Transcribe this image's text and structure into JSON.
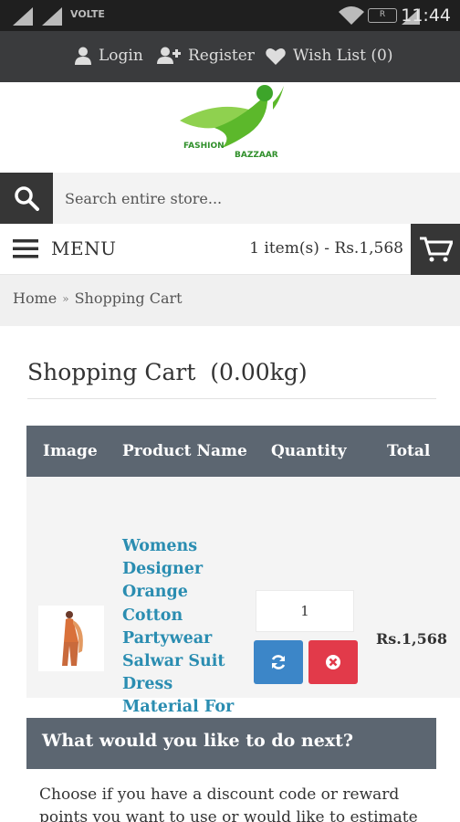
{
  "status_bar": {
    "network_label": "VOLTE",
    "r_badge": "R",
    "time": "11:44"
  },
  "top_nav": {
    "login": "Login",
    "register": "Register",
    "wishlist": "Wish List (0)"
  },
  "logo": {
    "line1": "FASHION",
    "line2": "BAZZAAR",
    "accent_green": "#5cb82b"
  },
  "search": {
    "placeholder": "Search entire store..."
  },
  "menu_bar": {
    "menu_label": "MENU",
    "cart_summary": "1 item(s) - Rs.1,568"
  },
  "breadcrumb": {
    "home": "Home",
    "separator": "»",
    "current": "Shopping Cart"
  },
  "page": {
    "title": "Shopping Cart  (0.00kg)"
  },
  "cart_table": {
    "headers": {
      "image": "Image",
      "product_name": "Product Name",
      "quantity": "Quantity",
      "total": "Total"
    },
    "rows": [
      {
        "product_name": "Womens Designer Orange Cotton Partywear Salwar Suit Dress Material For Womens",
        "quantity": "1",
        "total": "Rs.1,568"
      }
    ]
  },
  "next_section": {
    "heading": "What would you like to do next?",
    "body": "Choose if you have a discount code or reward points you want to use or would like to estimate"
  },
  "colors": {
    "header_dark": "#3a3b3d",
    "table_header": "#5c6671",
    "link_blue": "#2a8db1",
    "update_blue": "#3c86c8",
    "remove_red": "#e23a4a"
  }
}
